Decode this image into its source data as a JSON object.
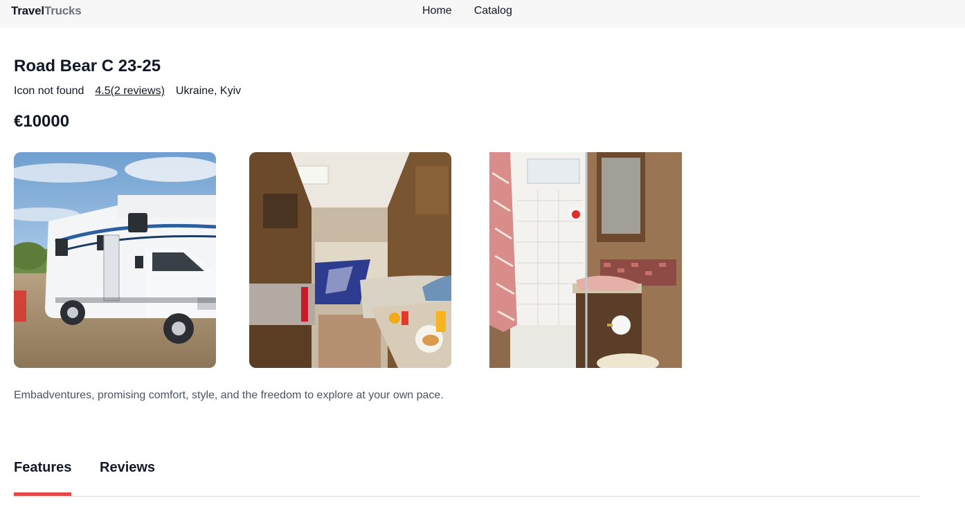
{
  "header": {
    "logo_part1": "Travel",
    "logo_part2": "Trucks",
    "nav": [
      {
        "label": "Home"
      },
      {
        "label": "Catalog"
      }
    ]
  },
  "camper": {
    "name": "Road Bear C 23-25",
    "icon_fallback_text": "Icon not found",
    "rating_text": "4.5(2 reviews)",
    "location": "Ukraine, Kyiv",
    "price": "€10000",
    "description": "Embadventures, promising comfort, style, and the freedom to explore at your own pace."
  },
  "gallery": [
    {
      "subject": "camper-exterior"
    },
    {
      "subject": "camper-interior"
    },
    {
      "subject": "camper-bathroom"
    }
  ],
  "tabs": [
    {
      "label": "Features",
      "active": true
    },
    {
      "label": "Reviews",
      "active": false
    }
  ],
  "colors": {
    "accent": "#e44848",
    "header_bg": "#f7f7f7",
    "text": "#101828",
    "muted_text": "#475467",
    "logo_secondary": "#6c717b"
  }
}
